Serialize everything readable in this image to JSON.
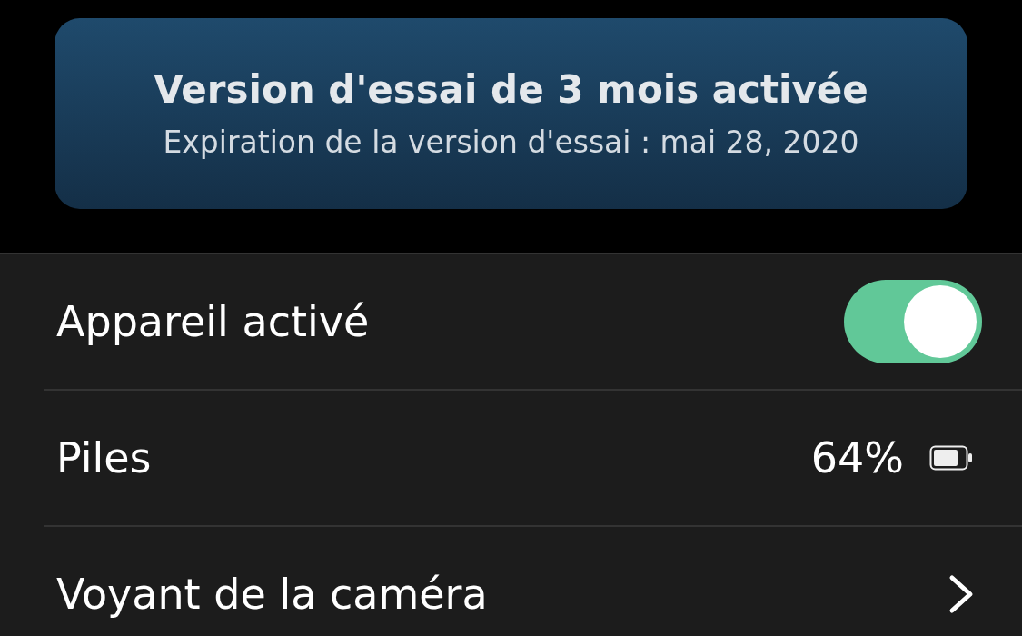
{
  "trial_banner": {
    "title": "Version d'essai de 3 mois activée",
    "subtitle": "Expiration de la version d'essai : mai 28, 2020"
  },
  "settings": [
    {
      "kind": "toggle",
      "label": "Appareil activé",
      "on": true
    },
    {
      "kind": "battery",
      "label": "Piles",
      "value": "64%"
    },
    {
      "kind": "link",
      "label": "Voyant de la caméra"
    }
  ]
}
